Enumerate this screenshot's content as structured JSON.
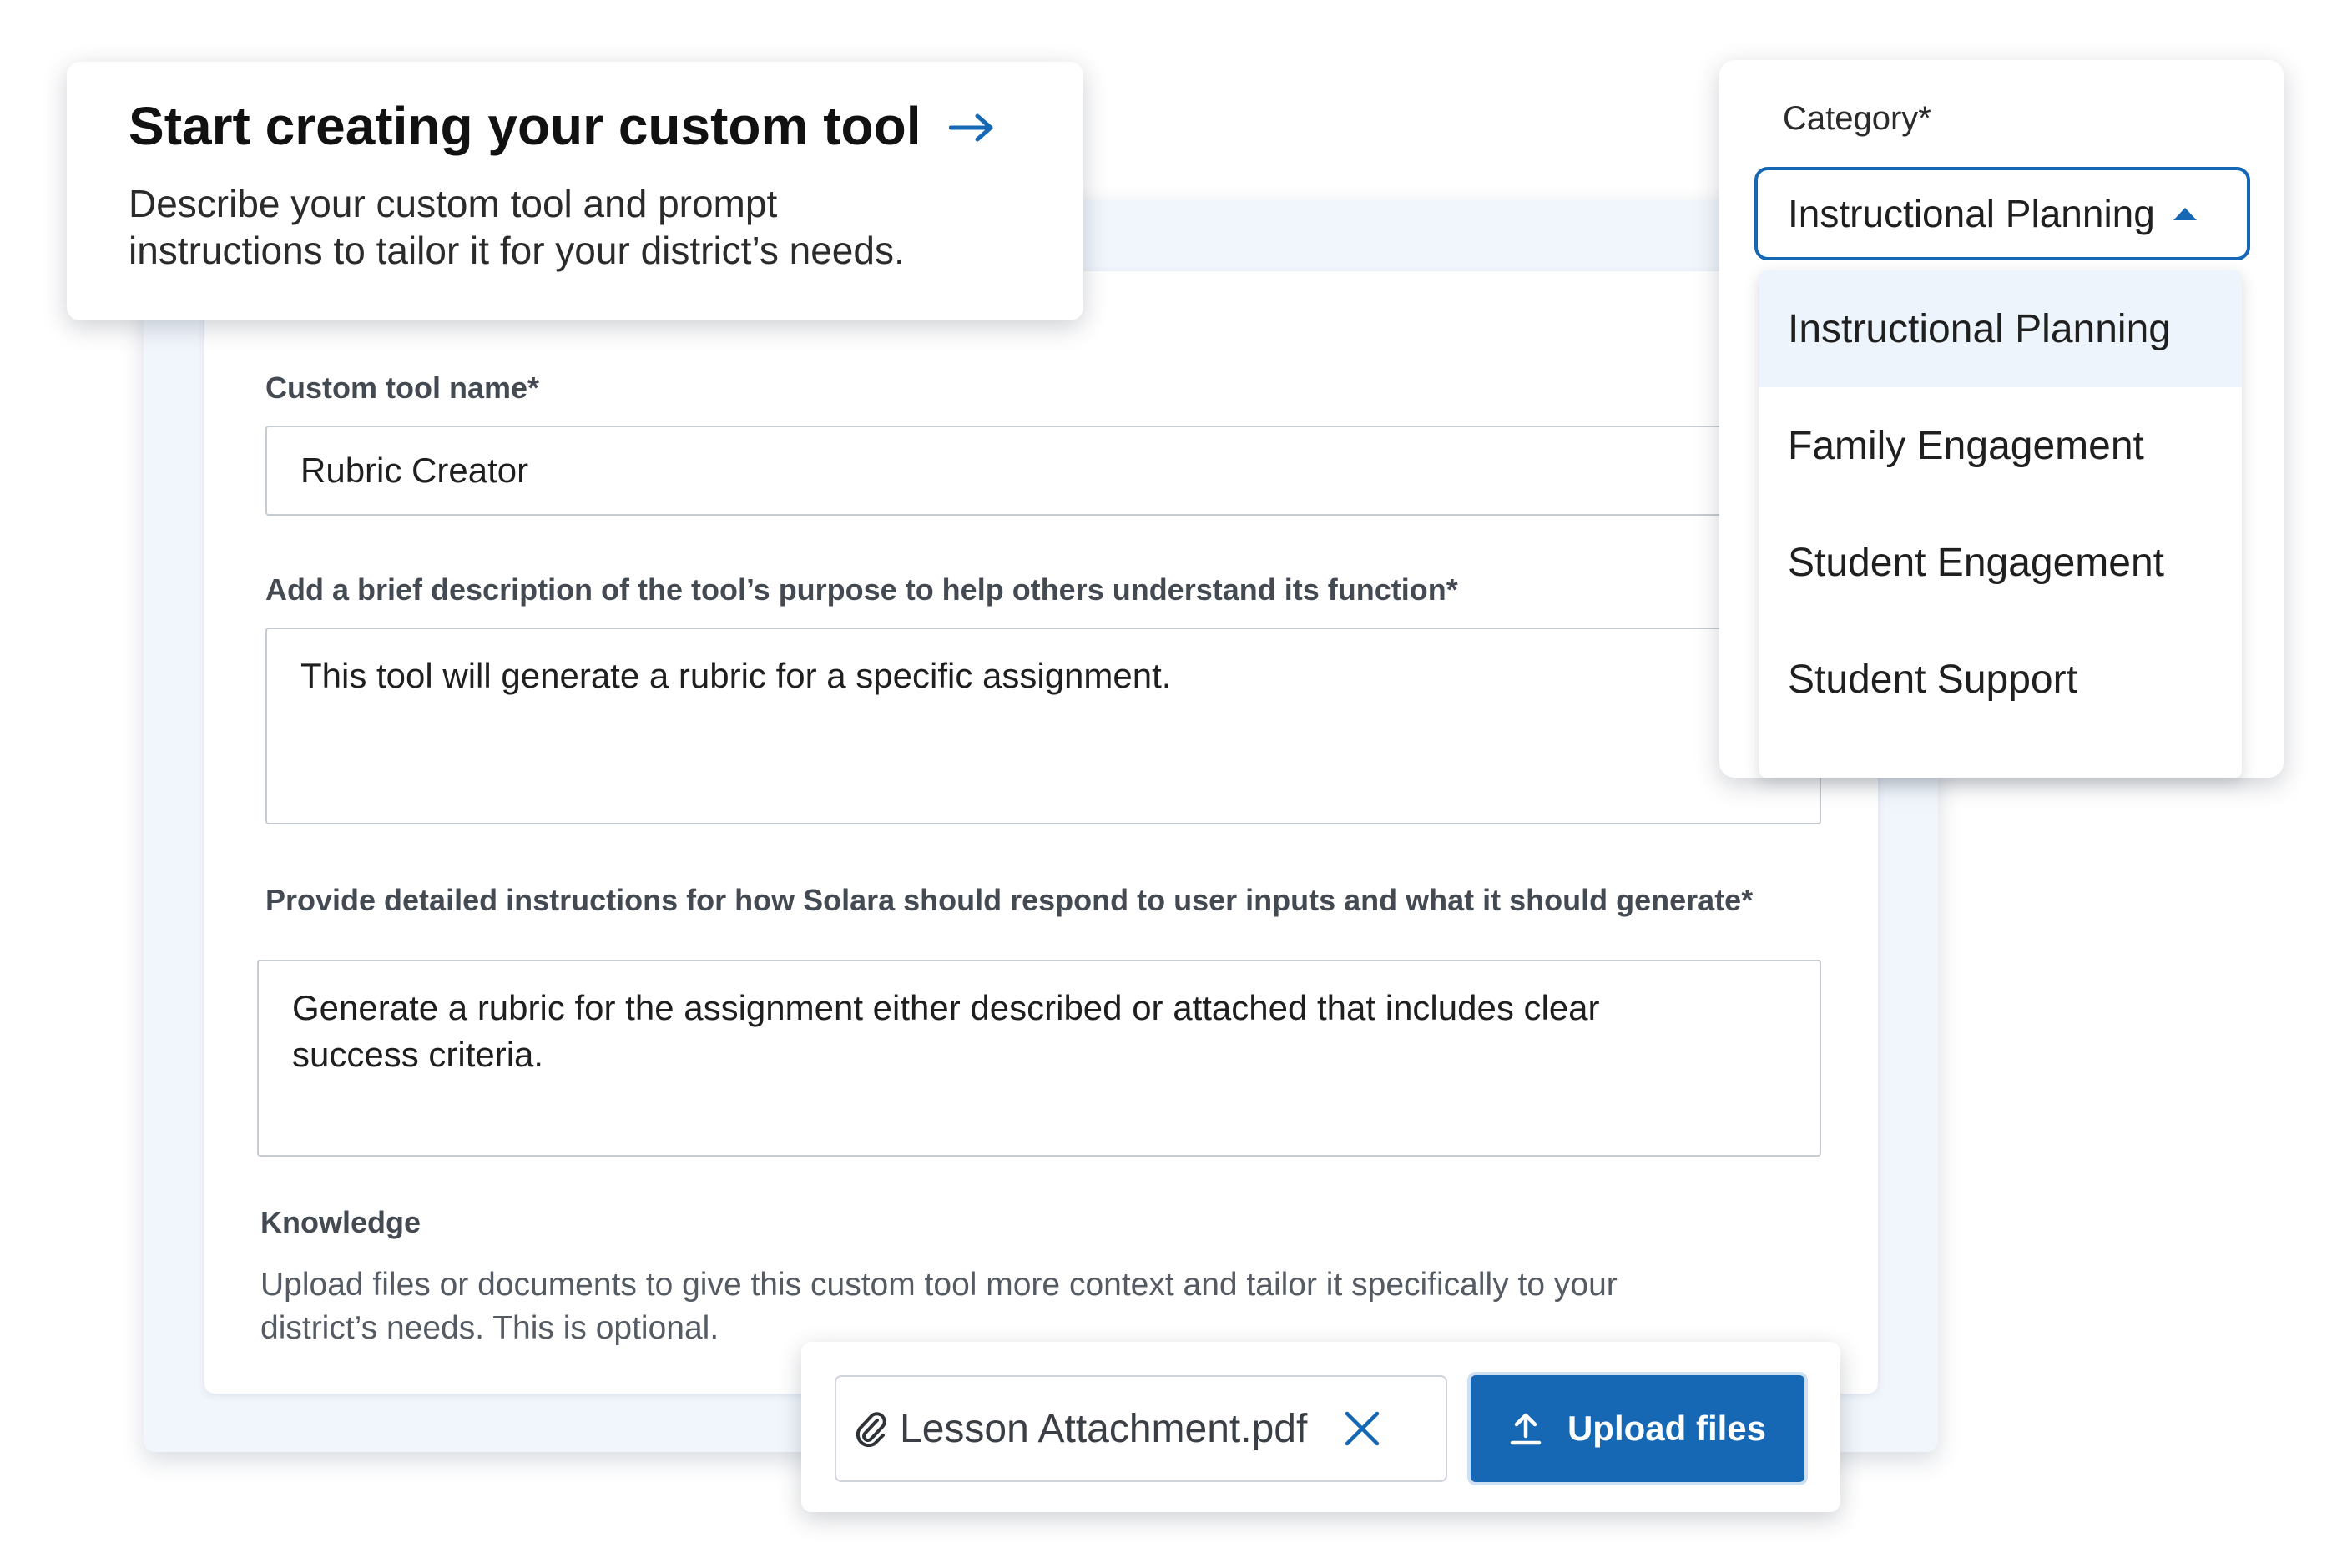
{
  "intro": {
    "title": "Start creating your custom tool",
    "arrow_icon": "arrow-right-icon",
    "description_line1": "Describe your custom tool and prompt",
    "description_line2": "instructions to tailor it for your district’s needs."
  },
  "form": {
    "name_label": "Custom tool name*",
    "name_value": "Rubric Creator",
    "description_label": "Add a brief description of the tool’s purpose to help others understand its function*",
    "description_value": "This tool will generate a rubric for a specific assignment.",
    "instructions_label": "Provide detailed instructions for how Solara should respond to user inputs and what it should generate*",
    "instructions_value_line1": "Generate a rubric for the assignment either described or attached that includes clear",
    "instructions_value_line2": "success criteria.",
    "knowledge_label": "Knowledge",
    "knowledge_helper_line1": "Upload files or documents to give this custom tool more context and tailor it specifically to your",
    "knowledge_helper_line2": "district’s needs. This is optional."
  },
  "category": {
    "label": "Category*",
    "selected": "Instructional Planning",
    "options": [
      "Instructional Planning",
      "Family Engagement",
      "Student Engagement",
      "Student Support"
    ]
  },
  "upload": {
    "file_name": "Lesson Attachment.pdf",
    "button_label": "Upload files"
  },
  "colors": {
    "accent": "#1667b4",
    "panel_bg": "#f1f6fc",
    "selected_option_bg": "#eef4fb"
  }
}
